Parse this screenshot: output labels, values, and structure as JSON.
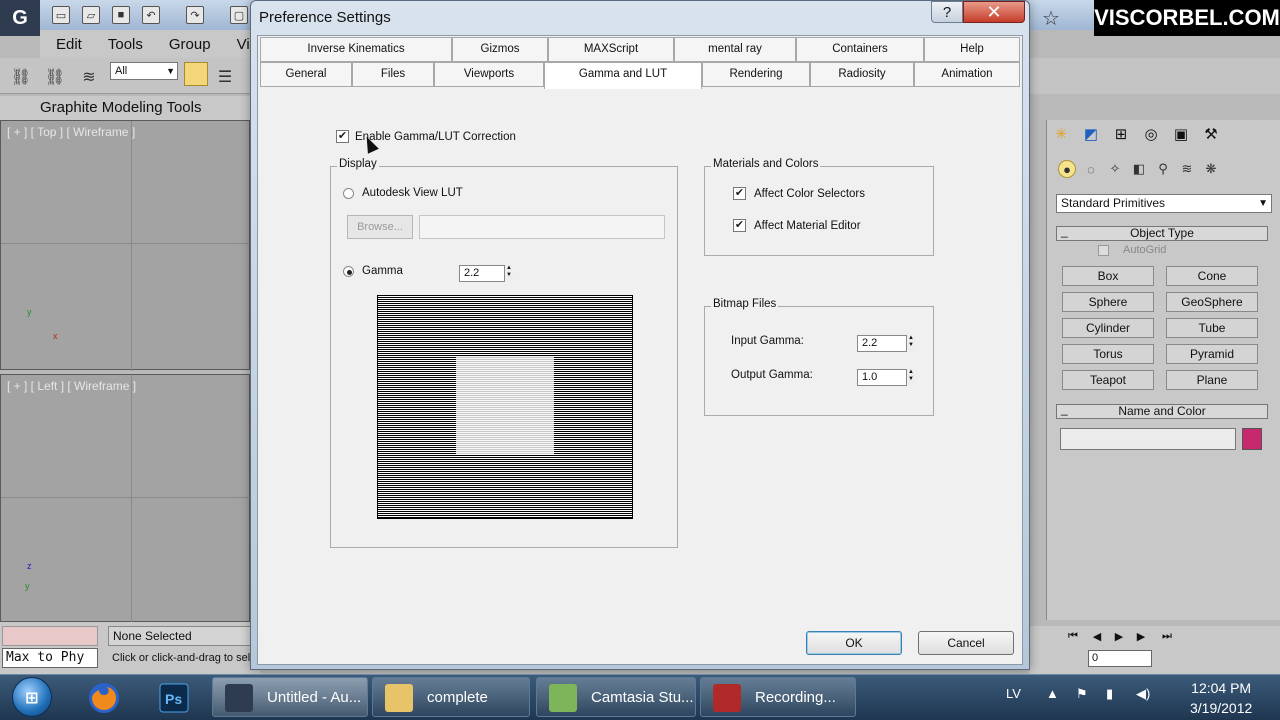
{
  "brand": "VISCORBEL.COM",
  "menubar": {
    "items": [
      "Edit",
      "Tools",
      "Group",
      "Vi"
    ]
  },
  "toolbar": {
    "filter_value": "All"
  },
  "ribbon": {
    "label": "Graphite Modeling Tools"
  },
  "viewports": {
    "top_label": "[ + ] [ Top ] [ Wireframe ]",
    "left_label": "[ + ] [ Left ] [ Wireframe ]"
  },
  "status": {
    "max_to_phy": "Max to Phy",
    "selection": "None Selected",
    "prompt": "Click or click-and-drag to select"
  },
  "dialog": {
    "title": "Preference Settings",
    "tabs_row1": [
      "Inverse Kinematics",
      "Gizmos",
      "MAXScript",
      "mental ray",
      "Containers",
      "Help"
    ],
    "tabs_row2": [
      "General",
      "Files",
      "Viewports",
      "Gamma and LUT",
      "Rendering",
      "Radiosity",
      "Animation"
    ],
    "active_tab": "Gamma and LUT",
    "enable_label": "Enable Gamma/LUT Correction",
    "display": {
      "title": "Display",
      "autodesk_lut": "Autodesk View LUT",
      "browse": "Browse...",
      "gamma_label": "Gamma",
      "gamma_value": "2.2"
    },
    "materials": {
      "title": "Materials and Colors",
      "affect_color_selectors": "Affect Color Selectors",
      "affect_material_editor": "Affect Material Editor"
    },
    "bitmap": {
      "title": "Bitmap Files",
      "input_gamma_label": "Input Gamma:",
      "input_gamma_value": "2.2",
      "output_gamma_label": "Output Gamma:",
      "output_gamma_value": "1.0"
    },
    "ok": "OK",
    "cancel": "Cancel"
  },
  "command_panel": {
    "dropdown": "Standard Primitives",
    "object_type_title": "Object Type",
    "autogrid": "AutoGrid",
    "buttons": [
      "Box",
      "Cone",
      "Sphere",
      "GeoSphere",
      "Cylinder",
      "Tube",
      "Torus",
      "Pyramid",
      "Teapot",
      "Plane"
    ],
    "name_color_title": "Name and Color",
    "object_color": "#c8286e"
  },
  "timeline": {
    "frame_value": "0"
  },
  "taskbar": {
    "tasks": [
      "Untitled - Au...",
      "complete",
      "Camtasia Stu...",
      "Recording..."
    ],
    "language": "LV",
    "time": "12:04 PM",
    "date": "3/19/2012"
  }
}
